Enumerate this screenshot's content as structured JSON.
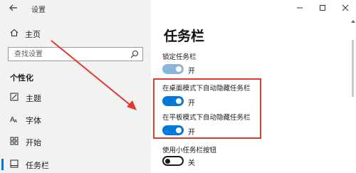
{
  "window": {
    "title": "设置"
  },
  "sidebar": {
    "home_label": "主页",
    "search_placeholder": "查找设置",
    "section_title": "个性化",
    "items": [
      {
        "label": "主题",
        "icon": "brush-icon",
        "active": false
      },
      {
        "label": "字体",
        "icon": "font-icon",
        "active": false
      },
      {
        "label": "开始",
        "icon": "start-tiles-icon",
        "active": false
      },
      {
        "label": "任务栏",
        "icon": "taskbar-icon",
        "active": true
      }
    ]
  },
  "main": {
    "page_title": "任务栏",
    "settings": [
      {
        "label": "锁定任务栏",
        "state": "开",
        "on": true
      },
      {
        "label": "在桌面模式下自动隐藏任务栏",
        "state": "开",
        "on": true
      },
      {
        "label": "在平板模式下自动隐藏任务栏",
        "state": "开",
        "on": true
      },
      {
        "label": "使用小任务栏按钮",
        "state": "关",
        "on": false
      }
    ]
  },
  "colors": {
    "accent": "#0078d7",
    "highlight_box": "#e03a2e",
    "annotation_arrow": "#e03a2e"
  }
}
